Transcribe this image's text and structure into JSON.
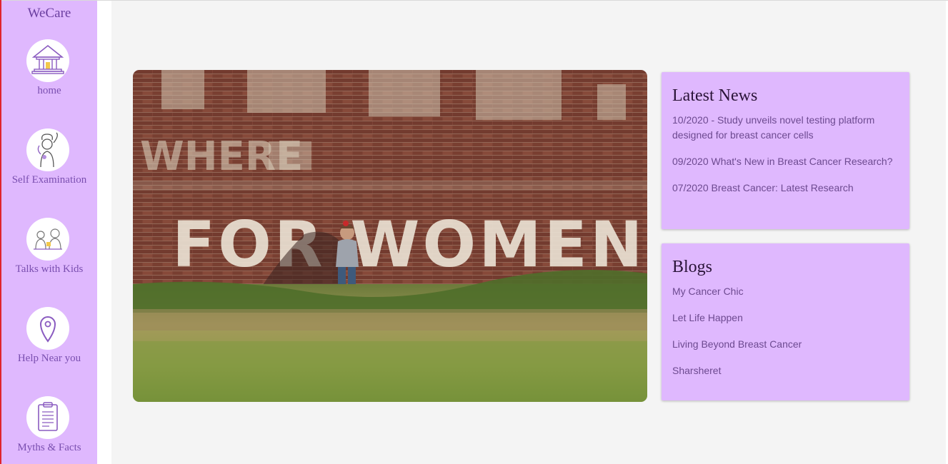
{
  "app": {
    "brand": "WeCare"
  },
  "sidebar": {
    "items": [
      {
        "label": "home",
        "icon": "home-icon"
      },
      {
        "label": "Self Examination",
        "icon": "self-examination-icon"
      },
      {
        "label": "Talks with Kids",
        "icon": "talks-with-kids-icon"
      },
      {
        "label": "Help Near you",
        "icon": "location-pin-icon"
      },
      {
        "label": "Myths & Facts",
        "icon": "clipboard-icon"
      }
    ]
  },
  "hero": {
    "wall_text_top": "WHERE",
    "wall_text_main": "FOR WOMEN"
  },
  "news": {
    "title": "Latest News",
    "items": [
      "10/2020 - Study unveils novel testing platform designed for breast cancer cells",
      "09/2020 What's New in Breast Cancer Research?",
      "07/2020 Breast Cancer: Latest Research"
    ]
  },
  "blogs": {
    "title": "Blogs",
    "items": [
      "My Cancer Chic",
      "Let Life Happen",
      "Living Beyond Breast Cancer",
      "Sharsheret"
    ]
  },
  "colors": {
    "sidebar_bg": "#dfb8fe",
    "card_bg": "#dfb8fe",
    "accent_purple": "#7a4fb0",
    "main_bg": "#f4f4f4",
    "left_edge": "#e0242c"
  }
}
